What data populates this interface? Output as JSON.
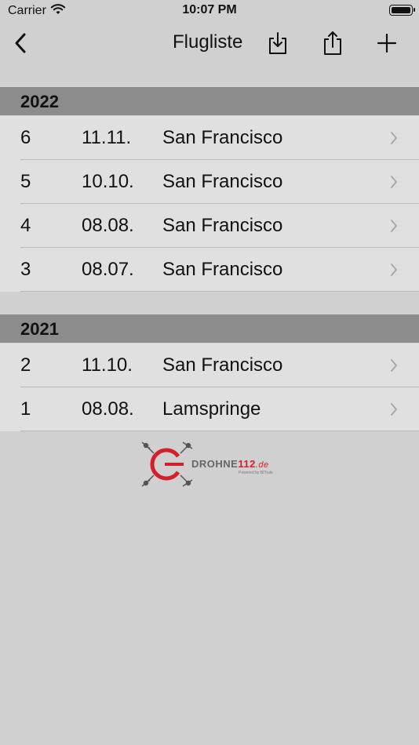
{
  "status_bar": {
    "carrier": "Carrier",
    "time": "10:07 PM"
  },
  "nav": {
    "title": "Flugliste",
    "back_icon": "chevron-left-icon",
    "download_icon": "download-icon",
    "share_icon": "share-icon",
    "add_icon": "plus-icon"
  },
  "sections": [
    {
      "year": "2022",
      "flights": [
        {
          "num": "6",
          "date": "11.11.",
          "place": "San Francisco"
        },
        {
          "num": "5",
          "date": "10.10.",
          "place": "San Francisco"
        },
        {
          "num": "4",
          "date": "08.08.",
          "place": "San Francisco"
        },
        {
          "num": "3",
          "date": "08.07.",
          "place": "San Francisco"
        }
      ]
    },
    {
      "year": "2021",
      "flights": [
        {
          "num": "2",
          "date": "11.10.",
          "place": "San Francisco"
        },
        {
          "num": "1",
          "date": "08.08.",
          "place": "Lamspringe"
        }
      ]
    }
  ],
  "logo": {
    "brand_main": "DROHNE",
    "brand_num": "112",
    "brand_tld": ".de",
    "powered": "Powered by BITrule"
  },
  "colors": {
    "background": "#d0d0d0",
    "section_header": "#8c8c8c",
    "row": "#e0e0e0",
    "brand_red": "#d4202a"
  }
}
